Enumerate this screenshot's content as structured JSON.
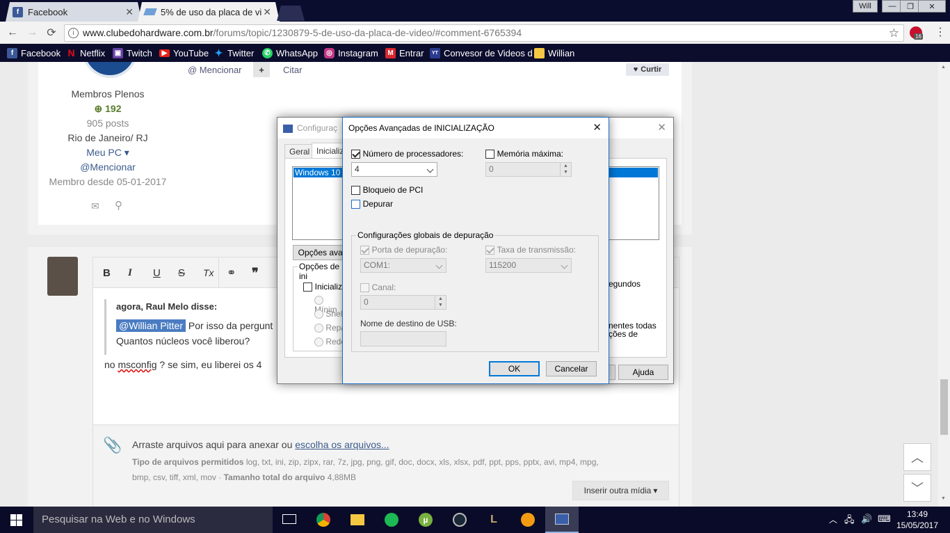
{
  "browser": {
    "tabs": [
      {
        "label": "Facebook",
        "active": false
      },
      {
        "label": "5% de uso da placa de vi",
        "active": true
      }
    ],
    "window_user": "Will",
    "url_host": "www.clubedohardware.com.br",
    "url_path": "/forums/topic/1230879-5-de-uso-da-placa-de-video/#comment-6765394",
    "extension_badge": "16",
    "bookmarks": [
      {
        "label": "Facebook",
        "icon": "facebook-icon",
        "color": "#3b5998"
      },
      {
        "label": "Netflix",
        "icon": "netflix-icon",
        "color": "#e50914"
      },
      {
        "label": "Twitch",
        "icon": "twitch-icon",
        "color": "#6441a4"
      },
      {
        "label": "YouTube",
        "icon": "youtube-icon",
        "color": "#e62117"
      },
      {
        "label": "Twitter",
        "icon": "twitter-icon",
        "color": "#1da1f2"
      },
      {
        "label": "WhatsApp",
        "icon": "whatsapp-icon",
        "color": "#25d366"
      },
      {
        "label": "Instagram",
        "icon": "instagram-icon",
        "color": "#c13584"
      },
      {
        "label": "Entrar",
        "icon": "mega-icon",
        "color": "#d9272e"
      },
      {
        "label": "Convesor de Videos d",
        "icon": "converter-icon",
        "color": "#2a3b8f"
      },
      {
        "label": "Willian",
        "icon": "folder-icon",
        "color": "#f4c842"
      }
    ]
  },
  "post": {
    "mention_label": "@ Mencionar",
    "quote_label": "Citar",
    "like_label": "Curtir",
    "rank": "Membros Plenos",
    "reputation": "192",
    "posts": "905 posts",
    "location": "Rio de Janeiro/ RJ",
    "my_pc": "Meu PC",
    "mention_link": "@Mencionar",
    "member_since": "Membro desde 05-01-2017"
  },
  "editor": {
    "toolbar": [
      "B",
      "I",
      "U",
      "S",
      "Tx",
      "link",
      "99"
    ],
    "quote_author": "agora, Raul Melo disse:",
    "quote_mention": "@Willian Pitter",
    "quote_line1": " Por isso da pergunt",
    "quote_line2": "Quantos núcleos você liberou?",
    "reply_pre": "no ",
    "reply_misspelled": "msconfig",
    "reply_post": " ? se sim, eu liberei os 4",
    "drop_text": "Arraste arquivos aqui para anexar ou ",
    "drop_link": "escolha os arquivos...",
    "allowed_label": "Tipo de arquivos permitidos",
    "allowed_types_1": " log, txt, ini, zip, zipx, rar, 7z, jpg, png, gif, doc, docx, xls, xlsx, pdf, ppt, pps, pptx, avi, mp4, mpg,",
    "allowed_types_2": "bmp, csv, tiff, xml, mov · ",
    "total_label": "Tamanho total do arquivo",
    "total_value": " 4,88MB",
    "insert_media": "Inserir outra mídia"
  },
  "msconfig": {
    "title": "Configuraç",
    "tabs": [
      "Geral",
      "Inicializ"
    ],
    "boot_entry": "Windows 10 (C",
    "advanced_btn": "Opções avan",
    "boot_options_group": "Opções de ini",
    "safe_boot": "Inicializa",
    "radios": [
      "Mínim",
      "Shell",
      "Repa",
      "Rede"
    ],
    "timeout_suffix": "egundos",
    "permanent_1": "nentes todas",
    "permanent_2": "ções de",
    "help_btn": "Ajuda"
  },
  "advanced": {
    "title": "Opções Avançadas de INICIALIZAÇÃO",
    "num_proc_label": "Número de processadores:",
    "num_proc_checked": true,
    "num_proc_value": "4",
    "max_mem_label": "Memória máxima:",
    "max_mem_checked": false,
    "max_mem_value": "0",
    "pci_lock_label": "Bloqueio de PCI",
    "debug_label": "Depurar",
    "global_debug_group": "Configurações globais de depuração",
    "debug_port_label": "Porta de depuração:",
    "debug_port_value": "COM1:",
    "baud_label": "Taxa de transmissão:",
    "baud_value": "115200",
    "channel_label": "Canal:",
    "channel_value": "0",
    "usb_label": "Nome de destino de USB:",
    "ok": "OK",
    "cancel": "Cancelar"
  },
  "taskbar": {
    "search_placeholder": "Pesquisar na Web e no Windows",
    "time": "13:49",
    "date": "15/05/2017"
  }
}
